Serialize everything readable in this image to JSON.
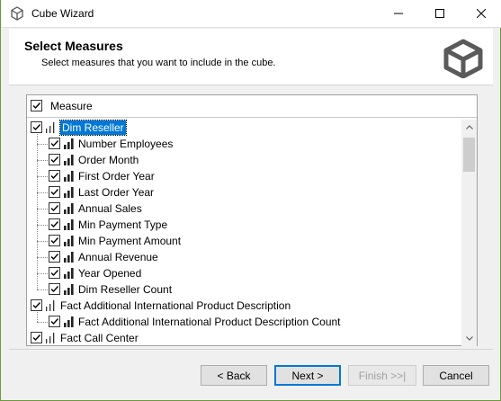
{
  "window": {
    "title": "Cube Wizard"
  },
  "header": {
    "title": "Select Measures",
    "subtitle": "Select measures that you want to include in the cube."
  },
  "list": {
    "column_header": "Measure",
    "items": [
      {
        "label": "Dim Reseller",
        "level": 0,
        "checked": true,
        "selected": true
      },
      {
        "label": "Number Employees",
        "level": 1,
        "checked": true
      },
      {
        "label": "Order Month",
        "level": 1,
        "checked": true
      },
      {
        "label": "First Order Year",
        "level": 1,
        "checked": true
      },
      {
        "label": "Last Order Year",
        "level": 1,
        "checked": true
      },
      {
        "label": "Annual Sales",
        "level": 1,
        "checked": true
      },
      {
        "label": "Min Payment Type",
        "level": 1,
        "checked": true
      },
      {
        "label": "Min Payment Amount",
        "level": 1,
        "checked": true
      },
      {
        "label": "Annual Revenue",
        "level": 1,
        "checked": true
      },
      {
        "label": "Year Opened",
        "level": 1,
        "checked": true
      },
      {
        "label": "Dim Reseller Count",
        "level": 1,
        "checked": true
      },
      {
        "label": "Fact Additional International Product Description",
        "level": 0,
        "checked": true
      },
      {
        "label": "Fact Additional International Product Description Count",
        "level": 1,
        "checked": true
      },
      {
        "label": "Fact Call Center",
        "level": 0,
        "checked": true
      }
    ]
  },
  "buttons": {
    "back": "< Back",
    "next": "Next >",
    "finish": "Finish >>|",
    "cancel": "Cancel"
  },
  "colors": {
    "selection": "#0078d7",
    "border_accent": "#6b9a3a"
  }
}
